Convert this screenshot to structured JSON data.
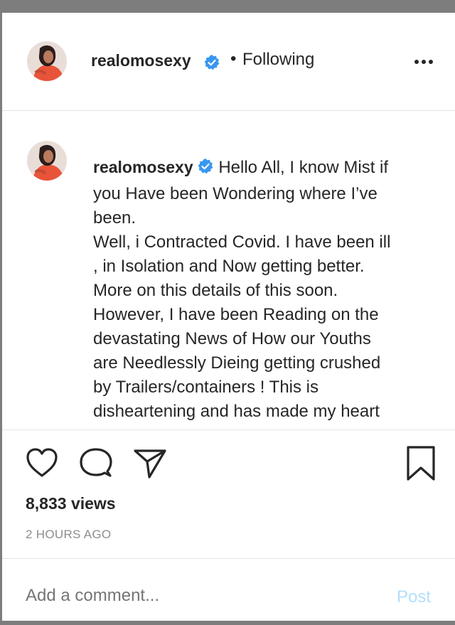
{
  "header": {
    "username": "realomosexy",
    "dot": "•",
    "follow_label": "Following",
    "more_icon": "more-horizontal-icon",
    "verified_icon": "verified-badge-icon"
  },
  "caption": {
    "username": "realomosexy",
    "lines": [
      "Hello All, I know Mist if",
      "you Have been Wondering where I’ve",
      "been.",
      "Well, i Contracted Covid. I have been ill",
      ", in Isolation and Now getting better.",
      "More on this details of this soon.",
      "However, I have been Reading on the",
      "devastating News of How our Youths",
      "are Needlessly Dieing getting crushed",
      "by Trailers/containers ! This is",
      "disheartening and has made my heart"
    ]
  },
  "actions": {
    "icons": [
      "heart-icon",
      "comment-icon",
      "share-icon",
      "bookmark-icon"
    ],
    "views": "8,833 views",
    "timestamp": "2 HOURS AGO"
  },
  "comment": {
    "placeholder": "Add a comment...",
    "post_label": "Post"
  },
  "colors": {
    "verified_blue": "#3897f0",
    "post_disabled": "#b2dffc",
    "muted_text": "#8e8e8e",
    "text": "#262626"
  }
}
